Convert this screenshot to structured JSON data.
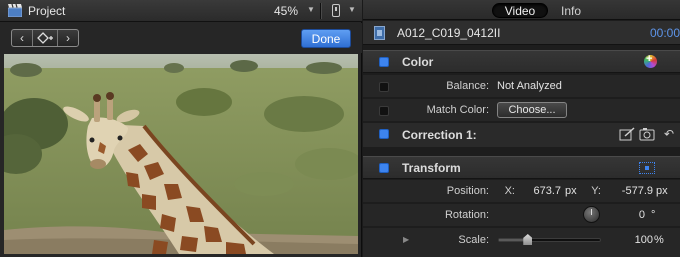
{
  "viewer": {
    "title": "Project",
    "zoom": "45%",
    "done_label": "Done",
    "icons": {
      "clapper": "clapperboard-icon",
      "back": "chevron-left-icon",
      "marker": "keyword-marker-icon",
      "forward": "chevron-right-icon"
    },
    "accent": "#3d7fe0"
  },
  "inspector": {
    "tabs": {
      "video": "Video",
      "info": "Info"
    },
    "clip": {
      "name": "A012_C019_0412II",
      "time": "00:00"
    },
    "color": {
      "title": "Color",
      "balance_label": "Balance:",
      "balance_value": "Not Analyzed",
      "match_label": "Match Color:",
      "choose_label": "Choose..."
    },
    "correction": {
      "title": "Correction 1:"
    },
    "transform": {
      "title": "Transform",
      "position_label": "Position:",
      "x_label": "X:",
      "x_value": "673.7",
      "x_unit": "px",
      "y_label": "Y:",
      "y_value": "-577.9",
      "y_unit": "px",
      "rotation_label": "Rotation:",
      "rotation_value": "0",
      "rotation_unit": "°",
      "scale_label": "Scale:",
      "scale_value": "100",
      "scale_unit": "%",
      "scale_slider_fraction": 0.28
    },
    "accent_blue": "#3d84ef"
  }
}
